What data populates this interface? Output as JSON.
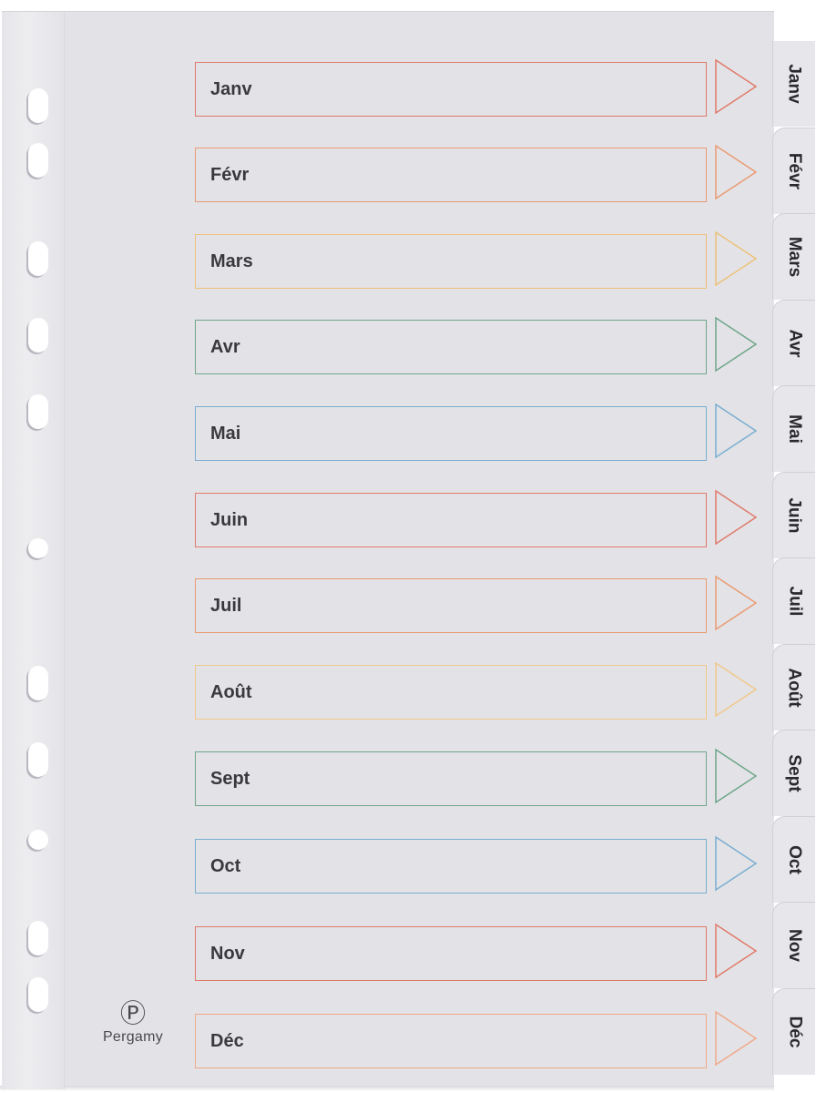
{
  "product": {
    "brand": "Pergamy",
    "brand_mark": "Ⓟ"
  },
  "rows": [
    {
      "label": "Janv",
      "color": "#e07a6a"
    },
    {
      "label": "Févr",
      "color": "#ea9a72"
    },
    {
      "label": "Mars",
      "color": "#eec07a"
    },
    {
      "label": "Avr",
      "color": "#6fa58a"
    },
    {
      "label": "Mai",
      "color": "#7aaed0"
    },
    {
      "label": "Juin",
      "color": "#e07a6a"
    },
    {
      "label": "Juil",
      "color": "#ea9a72"
    },
    {
      "label": "Août",
      "color": "#f0c88a"
    },
    {
      "label": "Sept",
      "color": "#6fa58a"
    },
    {
      "label": "Oct",
      "color": "#7aaed0"
    },
    {
      "label": "Nov",
      "color": "#e07a6a"
    },
    {
      "label": "Déc",
      "color": "#f0a98a"
    }
  ],
  "tabs": [
    "Janv",
    "Févr",
    "Mars",
    "Avr",
    "Mai",
    "Juin",
    "Juil",
    "Août",
    "Sept",
    "Oct",
    "Nov",
    "Déc"
  ]
}
